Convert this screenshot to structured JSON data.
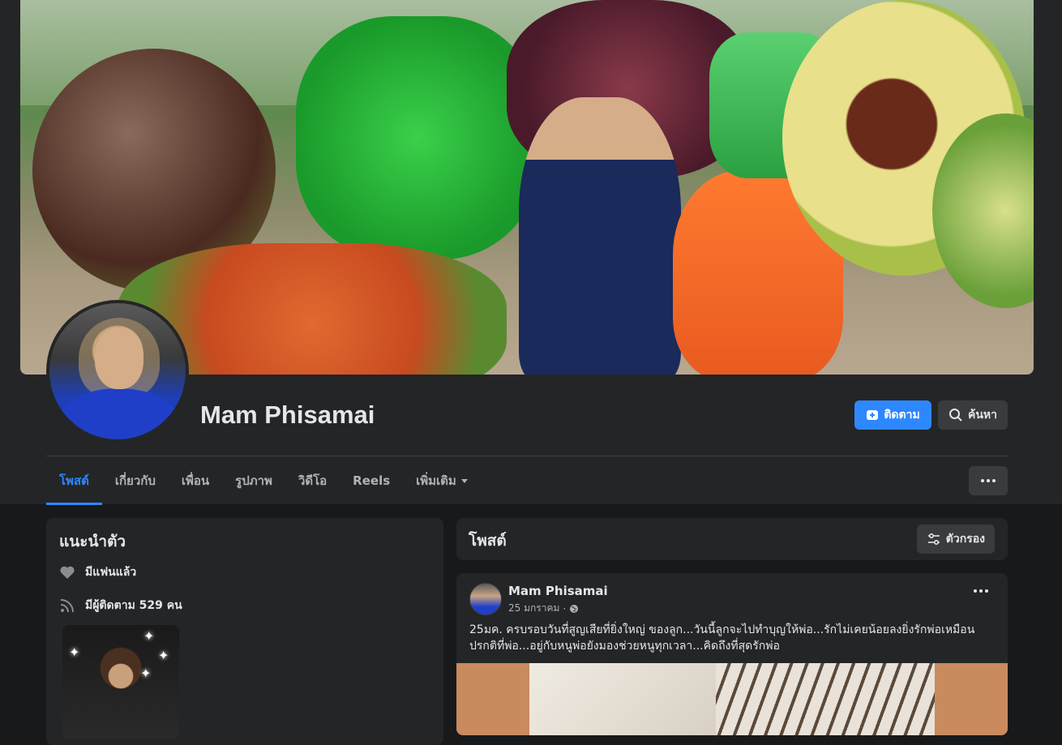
{
  "profile": {
    "name": "Mam Phisamai",
    "follow_label": "ติดตาม",
    "search_label": "ค้นหา"
  },
  "tabs": [
    {
      "label": "โพสต์",
      "active": true
    },
    {
      "label": "เกี่ยวกับ"
    },
    {
      "label": "เพื่อน"
    },
    {
      "label": "รูปภาพ"
    },
    {
      "label": "วิดีโอ"
    },
    {
      "label": "Reels"
    },
    {
      "label": "เพิ่มเติม"
    }
  ],
  "intro": {
    "title": "แนะนำตัว",
    "relationship": "มีแฟนแล้ว",
    "followers": "มีผู้ติดตาม 529 คน"
  },
  "posts": {
    "title": "โพสต์",
    "filter_label": "ตัวกรอง",
    "first": {
      "author": "Mam Phisamai",
      "date": "25 มกราคม",
      "separator": "·",
      "text": "25มค. ครบรอบวันที่สูญเสียที่ยิ่งใหญ่ ของลูก...วันนี้ลูกจะไปทำบุญให้พ่อ...รักไม่เคยน้อยลงยิ่งรักพ่อเหมือนปรกติที่พ่อ...อยู่กับหนูพ่อยังมองช่วยหนูทุกเวลา...คิดถึงที่สุดรักพ่อ"
    }
  },
  "colors": {
    "accent": "#2d88ff",
    "surface": "#242526",
    "background": "#18191a",
    "button": "#3a3b3c"
  }
}
